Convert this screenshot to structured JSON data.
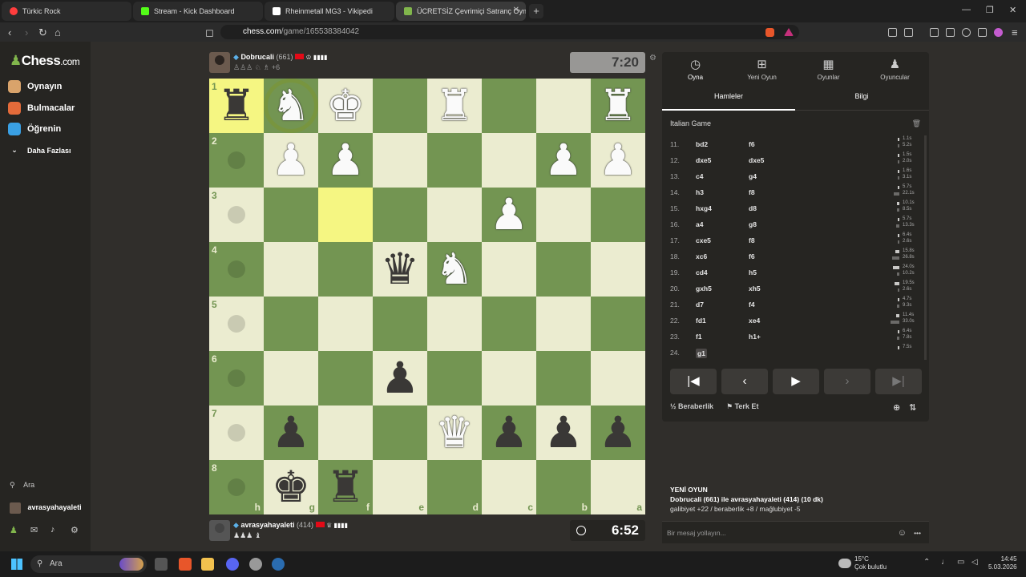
{
  "browser": {
    "tabs": [
      {
        "title": "Türkic Rock",
        "color": "#ff3d3d"
      },
      {
        "title": "Stream - Kick Dashboard",
        "color": "#53fc18"
      },
      {
        "title": "Rheinmetall MG3 - Vikipedi",
        "color": "#ffffff"
      },
      {
        "title": "ÜCRETSİZ Çevrimiçi Satranç Oyna",
        "color": "#81b64c"
      }
    ],
    "url_host": "chess.com",
    "url_path": "/game/165538384042"
  },
  "sidebar": {
    "logo": "Chess",
    "logo_suffix": ".com",
    "items": [
      {
        "label": "Oynayın",
        "icon": "play-icon",
        "color": "#d9a36b"
      },
      {
        "label": "Bulmacalar",
        "icon": "puzzle-icon",
        "color": "#e46b3a"
      },
      {
        "label": "Öğrenin",
        "icon": "learn-icon",
        "color": "#3aa0e4"
      },
      {
        "label": "Daha Fazlası",
        "icon": "chevron-down-icon",
        "color": "#262522"
      }
    ],
    "search_label": "Ara",
    "username": "avrasyahayaleti"
  },
  "players": {
    "top": {
      "name": "Dobrucali",
      "rating": "(661)",
      "extra": "+6"
    },
    "bottom": {
      "name": "avrasyahayaleti",
      "rating": "(414)"
    }
  },
  "clocks": {
    "top": "7:20",
    "bottom": "6:52"
  },
  "board": {
    "ranks": [
      "1",
      "2",
      "3",
      "4",
      "5",
      "6",
      "7",
      "8"
    ],
    "files": [
      "h",
      "g",
      "f",
      "e",
      "d",
      "c",
      "b",
      "a"
    ],
    "light": "#ebecd0",
    "dark": "#739552",
    "highlight": "#f5f682",
    "pieces": [
      {
        "sq": "h1",
        "glyph": "♜",
        "color": "b"
      },
      {
        "sq": "g1",
        "glyph": "♞",
        "color": "w"
      },
      {
        "sq": "f1",
        "glyph": "♚",
        "color": "w"
      },
      {
        "sq": "d1",
        "glyph": "♜",
        "color": "w"
      },
      {
        "sq": "a1",
        "glyph": "♜",
        "color": "w"
      },
      {
        "sq": "g2",
        "glyph": "♟",
        "color": "w"
      },
      {
        "sq": "f2",
        "glyph": "♟",
        "color": "w"
      },
      {
        "sq": "b2",
        "glyph": "♟",
        "color": "w"
      },
      {
        "sq": "a2",
        "glyph": "♟",
        "color": "w"
      },
      {
        "sq": "c3",
        "glyph": "♟",
        "color": "w"
      },
      {
        "sq": "e4",
        "glyph": "♛",
        "color": "b"
      },
      {
        "sq": "d4",
        "glyph": "♞",
        "color": "w"
      },
      {
        "sq": "e6",
        "glyph": "♟",
        "color": "b"
      },
      {
        "sq": "g7",
        "glyph": "♟",
        "color": "b"
      },
      {
        "sq": "d7",
        "glyph": "♛",
        "color": "w"
      },
      {
        "sq": "c7",
        "glyph": "♟",
        "color": "b"
      },
      {
        "sq": "b7",
        "glyph": "♟",
        "color": "b"
      },
      {
        "sq": "a7",
        "glyph": "♟",
        "color": "b"
      },
      {
        "sq": "g8",
        "glyph": "♚",
        "color": "b"
      },
      {
        "sq": "f8",
        "glyph": "♜",
        "color": "b"
      }
    ],
    "highlighted": [
      "h1",
      "f3"
    ],
    "dots": [
      "h2",
      "h3",
      "h4",
      "h5",
      "h6",
      "h7",
      "h8"
    ],
    "ring": "g1"
  },
  "panel": {
    "tabs": [
      {
        "label": "Oyna",
        "icon": "clock-icon"
      },
      {
        "label": "Yeni Oyun",
        "icon": "plus-icon"
      },
      {
        "label": "Oyunlar",
        "icon": "board-icon"
      },
      {
        "label": "Oyuncular",
        "icon": "players-icon"
      }
    ],
    "subtabs": [
      "Hamleler",
      "Bilgi"
    ],
    "opening": "Italian Game",
    "moves": [
      {
        "n": "11.",
        "w": "bd2",
        "b": "f6",
        "tw": "1.1s",
        "tb": "5.2s"
      },
      {
        "n": "12.",
        "w": "dxe5",
        "b": "dxe5",
        "tw": "1.5s",
        "tb": "2.0s"
      },
      {
        "n": "13.",
        "w": "c4",
        "b": "g4",
        "tw": "1.6s",
        "tb": "3.1s"
      },
      {
        "n": "14.",
        "w": "h3",
        "b": "f8",
        "tw": "5.7s",
        "tb": "22.1s"
      },
      {
        "n": "15.",
        "w": "hxg4",
        "b": "d8",
        "tw": "10.1s",
        "tb": "8.5s"
      },
      {
        "n": "16.",
        "w": "a4",
        "b": "g8",
        "tw": "5.7s",
        "tb": "13.3s"
      },
      {
        "n": "17.",
        "w": "cxe5",
        "b": "f8",
        "tw": "6.4s",
        "tb": "2.6s"
      },
      {
        "n": "18.",
        "w": "xc6",
        "b": "f6",
        "tw": "15.8s",
        "tb": "26.8s"
      },
      {
        "n": "19.",
        "w": "cd4",
        "b": "h5",
        "tw": "24.0s",
        "tb": "10.2s"
      },
      {
        "n": "20.",
        "w": "gxh5",
        "b": "xh5",
        "tw": "19.5s",
        "tb": "2.6s"
      },
      {
        "n": "21.",
        "w": "d7",
        "b": "f4",
        "tw": "4.7s",
        "tb": "9.3s"
      },
      {
        "n": "22.",
        "w": "fd1",
        "b": "xe4",
        "tw": "11.4s",
        "tb": "33.0s"
      },
      {
        "n": "23.",
        "w": "f1",
        "b": "h1+",
        "tw": "6.4s",
        "tb": "7.8s"
      },
      {
        "n": "24.",
        "w": "g1",
        "b": "",
        "tw": "7.5s",
        "tb": ""
      }
    ],
    "draw_label": "Beraberlik",
    "resign_label": "Terk Et",
    "newgame_title": "YENİ OYUN",
    "newgame_line1": "Dobrucali (661) ile avrasyahayaleti (414) (10 dk)",
    "newgame_line2": "galibiyet +22 / beraberlik +8 / mağlubiyet -5",
    "chat_placeholder": "Bir mesaj yollayın..."
  },
  "taskbar": {
    "search": "Ara",
    "temp": "15°C",
    "weather": "Çok bulutlu",
    "time": "14:45",
    "date": "5.03.2026"
  }
}
